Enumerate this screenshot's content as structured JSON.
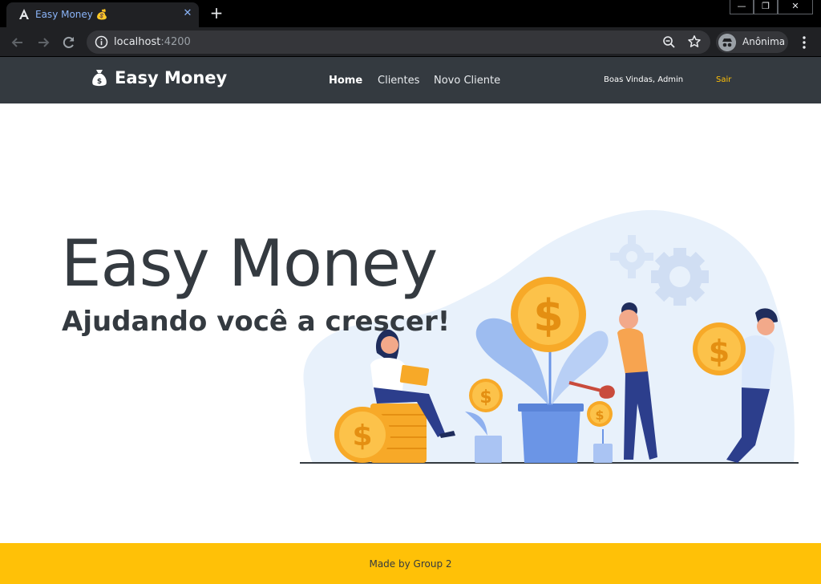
{
  "browser": {
    "tab_title": "Easy Money 💰",
    "tab_close": "✕",
    "new_tab": "+",
    "url_host": "localhost",
    "url_port": ":4200",
    "profile_label": "Anônima",
    "window_controls": {
      "minimize": "—",
      "restore": "❐",
      "close": "✕"
    }
  },
  "navbar": {
    "brand": "Easy Money",
    "links": [
      {
        "label": "Home",
        "active": true
      },
      {
        "label": "Clientes",
        "active": false
      },
      {
        "label": "Novo Cliente",
        "active": false
      }
    ],
    "welcome": "Boas Vindas, Admin",
    "logout": "Sair"
  },
  "hero": {
    "title": "Easy Money",
    "subtitle": "Ajudando você a crescer!"
  },
  "footer": {
    "text": "Made by Group 2"
  },
  "colors": {
    "navbar_bg": "#343a40",
    "footer_bg": "#ffc107",
    "accent_yellow": "#ffc107",
    "coin": "#f9b934",
    "illustration_blue": "#e8f1fb"
  }
}
